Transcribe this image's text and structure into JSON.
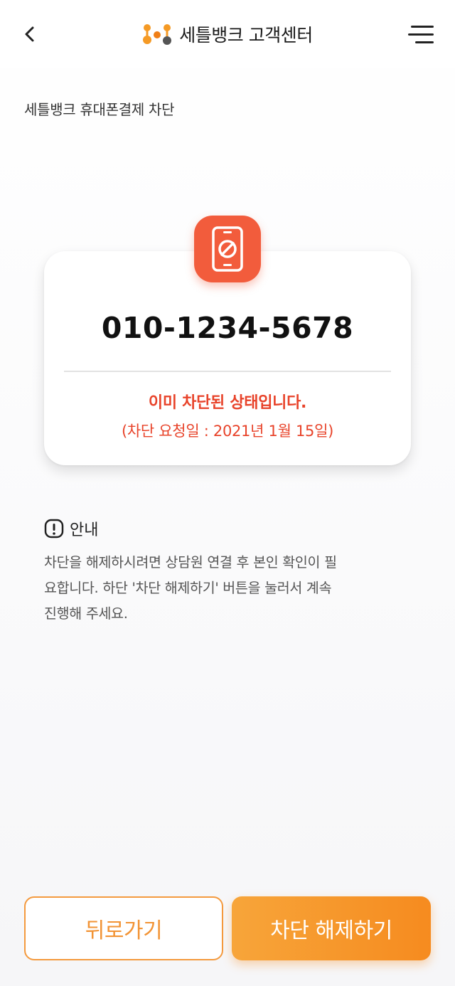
{
  "header": {
    "back_icon": "chevron-left-icon",
    "logo_icon": "settlebank-logo-icon",
    "title": "세틀뱅크 고객센터",
    "menu_icon": "hamburger-menu-icon"
  },
  "breadcrumb": "세틀뱅크 휴대폰결제 차단",
  "card": {
    "icon": "phone-blocked-icon",
    "phone_number": "010-1234-5678",
    "status": "이미 차단된 상태입니다.",
    "request_date": "(차단 요청일 : 2021년 1월 15일)"
  },
  "notice": {
    "icon": "exclamation-icon",
    "title": "안내",
    "lines": [
      "차단을 해제하시려면 상담원 연결 후 본인 확인이 필",
      "요합니다. 하단 '차단 해제하기' 버튼을 눌러서 계속",
      "진행해 주세요."
    ]
  },
  "buttons": {
    "back": "뒤로가기",
    "unblock": "차단 해제하기"
  },
  "colors": {
    "accent": "#f68b1f",
    "alert": "#e8432a",
    "icon_bg": "#f25c3c"
  }
}
